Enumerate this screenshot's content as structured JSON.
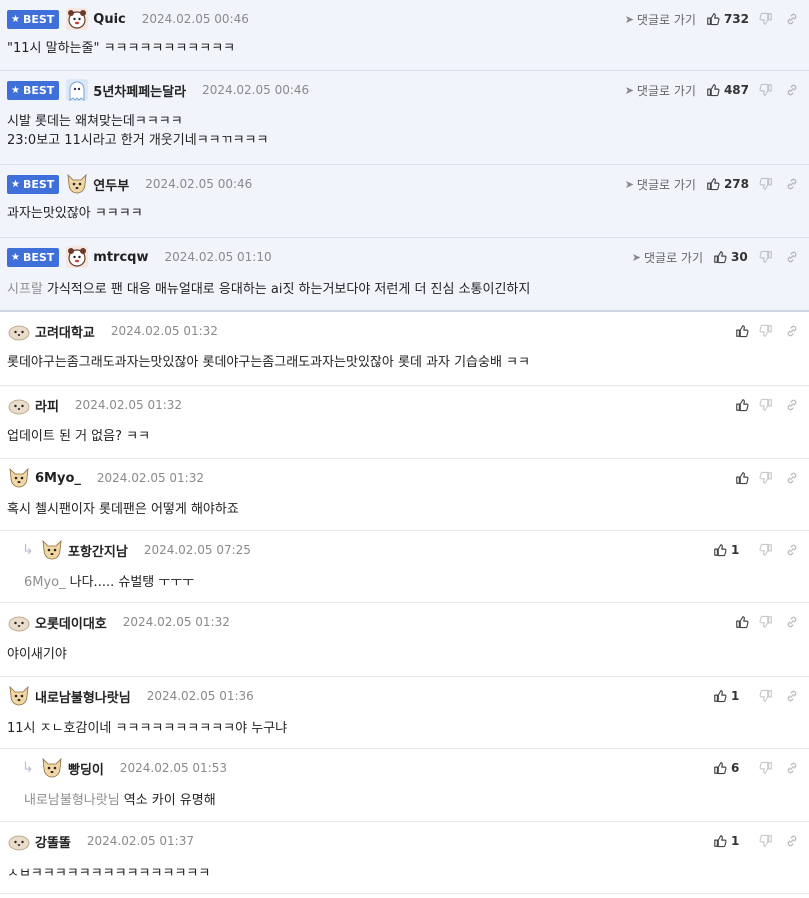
{
  "badge_label": "BEST",
  "reply_link_label": "댓글로 가기",
  "comments": [
    {
      "best": true,
      "nick": "Quic",
      "date": "2024.02.05 00:46",
      "likes": "732",
      "lines": [
        "\"11시 말하는줄\" ㅋㅋㅋㅋㅋㅋㅋㅋㅋㅋㅋ"
      ]
    },
    {
      "best": true,
      "nick": "5년차페페는달라",
      "date": "2024.02.05 00:46",
      "likes": "487",
      "lines": [
        "시발 롯데는 왜쳐맞는데ㅋㅋㅋㅋ",
        "23:0보고 11시라고 한거 개웃기네ㅋㅋㄲㅋㅋㅋ"
      ]
    },
    {
      "best": true,
      "nick": "연두부",
      "date": "2024.02.05 00:46",
      "likes": "278",
      "lines": [
        "과자는맛있잖아 ㅋㅋㅋㅋ"
      ]
    },
    {
      "best": true,
      "nick": "mtrcqw",
      "date": "2024.02.05 01:10",
      "likes": "30",
      "mention": "시프랄",
      "lines": [
        "가식적으로 팬 대응 매뉴얼대로 응대하는 ai짓 하는거보다야 저런게 더 진심 소통이긴하지"
      ]
    },
    {
      "nick": "고려대학교",
      "date": "2024.02.05 01:32",
      "likes": "",
      "lines": [
        "롯데야구는좀그래도과자는맛있잖아 롯데야구는좀그래도과자는맛있잖아 롯데 과자 기습숭배 ㅋㅋ"
      ]
    },
    {
      "nick": "라피",
      "date": "2024.02.05 01:32",
      "likes": "",
      "lines": [
        "업데이트 된 거 없음? ㅋㅋ"
      ]
    },
    {
      "nick": "6Myo_",
      "date": "2024.02.05 01:32",
      "likes": "",
      "lines": [
        "혹시 첼시팬이자 롯데팬은 어떻게 해야하죠"
      ]
    },
    {
      "reply": true,
      "nick": "포항간지남",
      "date": "2024.02.05 07:25",
      "likes": "1",
      "mention": "6Myo_",
      "lines": [
        "나다..... 슈벌탱 ㅜㅜㅜ"
      ]
    },
    {
      "nick": "오롯데이대호",
      "date": "2024.02.05 01:32",
      "likes": "",
      "lines": [
        "야이새기야"
      ]
    },
    {
      "nick": "내로남불형나랏님",
      "date": "2024.02.05 01:36",
      "likes": "1",
      "lines": [
        "11시 ㅈㄴ호감이네 ㅋㅋㅋㅋㅋㅋㅋㅋㅋㅋ야 누구냐"
      ]
    },
    {
      "reply": true,
      "nick": "빵딩이",
      "date": "2024.02.05 01:53",
      "likes": "6",
      "mention": "내로남불형나랏님",
      "lines": [
        "역소 카이 유명해"
      ]
    },
    {
      "nick": "강똘똘",
      "date": "2024.02.05 01:37",
      "likes": "1",
      "lines": [
        "ㅅㅂㅋㅋㅋㅋㅋㅋㅋㅋㅋㅋㅋㅋㅋㅋㅋ"
      ]
    }
  ]
}
